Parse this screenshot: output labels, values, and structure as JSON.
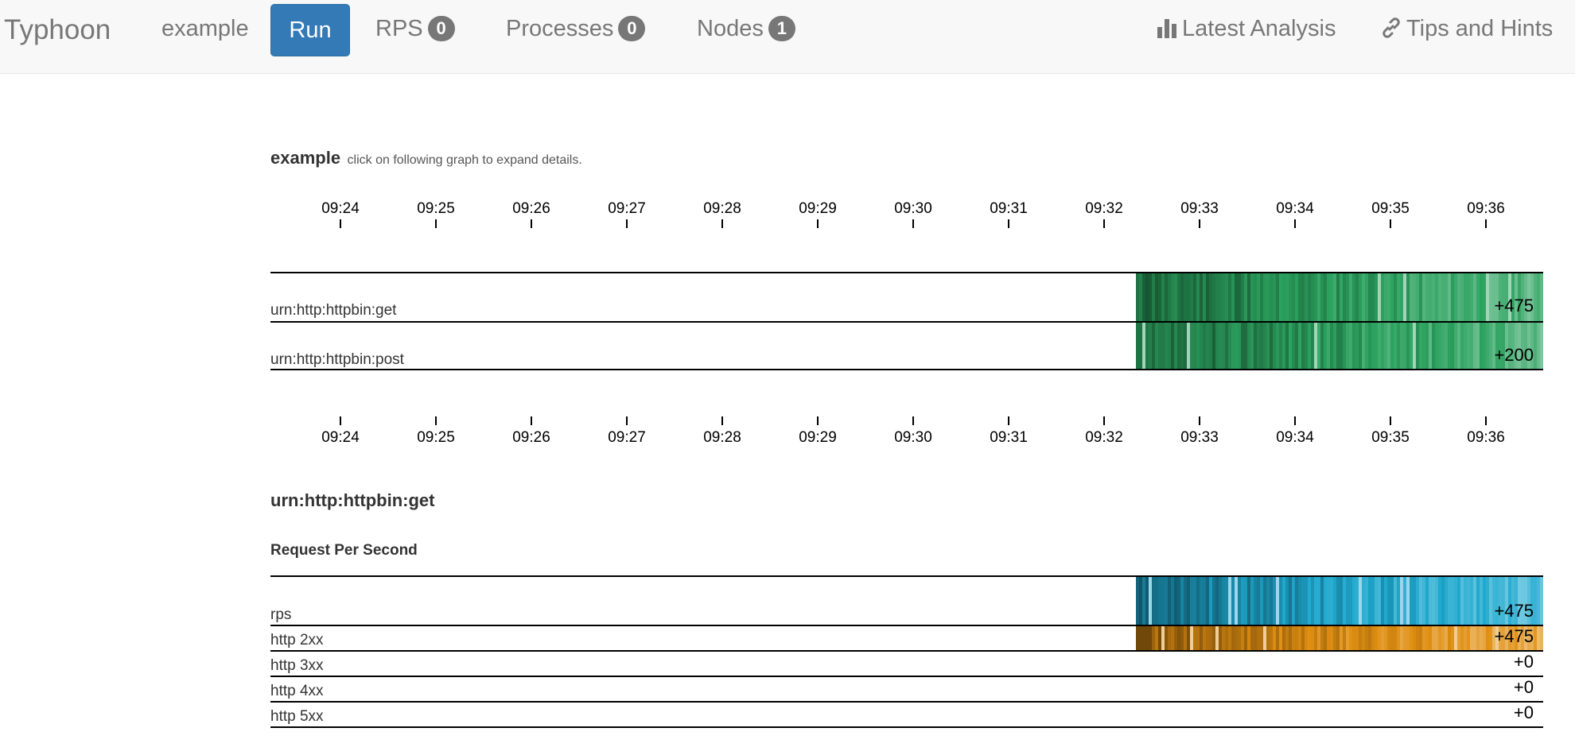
{
  "nav": {
    "brand": "Typhoon",
    "example": "example",
    "run": "Run",
    "rps_label": "RPS",
    "rps_count": "0",
    "processes_label": "Processes",
    "processes_count": "0",
    "nodes_label": "Nodes",
    "nodes_count": "1",
    "latest_analysis": "Latest Analysis",
    "tips_hints": "Tips and Hints"
  },
  "overview": {
    "title": "example",
    "hint": "click on following graph to expand details.",
    "ticks": [
      "09:24",
      "09:25",
      "09:26",
      "09:27",
      "09:28",
      "09:29",
      "09:30",
      "09:31",
      "09:32",
      "09:33",
      "09:34",
      "09:35",
      "09:36"
    ],
    "rows": [
      {
        "label": "urn:http:httpbin:get",
        "value": "+475",
        "color": "#2ca25f"
      },
      {
        "label": "urn:http:httpbin:post",
        "value": "+200",
        "color": "#2ca25f"
      }
    ]
  },
  "detail": {
    "title": "urn:http:httpbin:get",
    "subtitle": "Request Per Second",
    "rows": [
      {
        "label": "rps",
        "value": "+475",
        "color": "#1fa9cf"
      },
      {
        "label": "http 2xx",
        "value": "+475",
        "color": "#e08f12"
      },
      {
        "label": "http 3xx",
        "value": "+0"
      },
      {
        "label": "http 4xx",
        "value": "+0"
      },
      {
        "label": "http 5xx",
        "value": "+0"
      }
    ]
  }
}
